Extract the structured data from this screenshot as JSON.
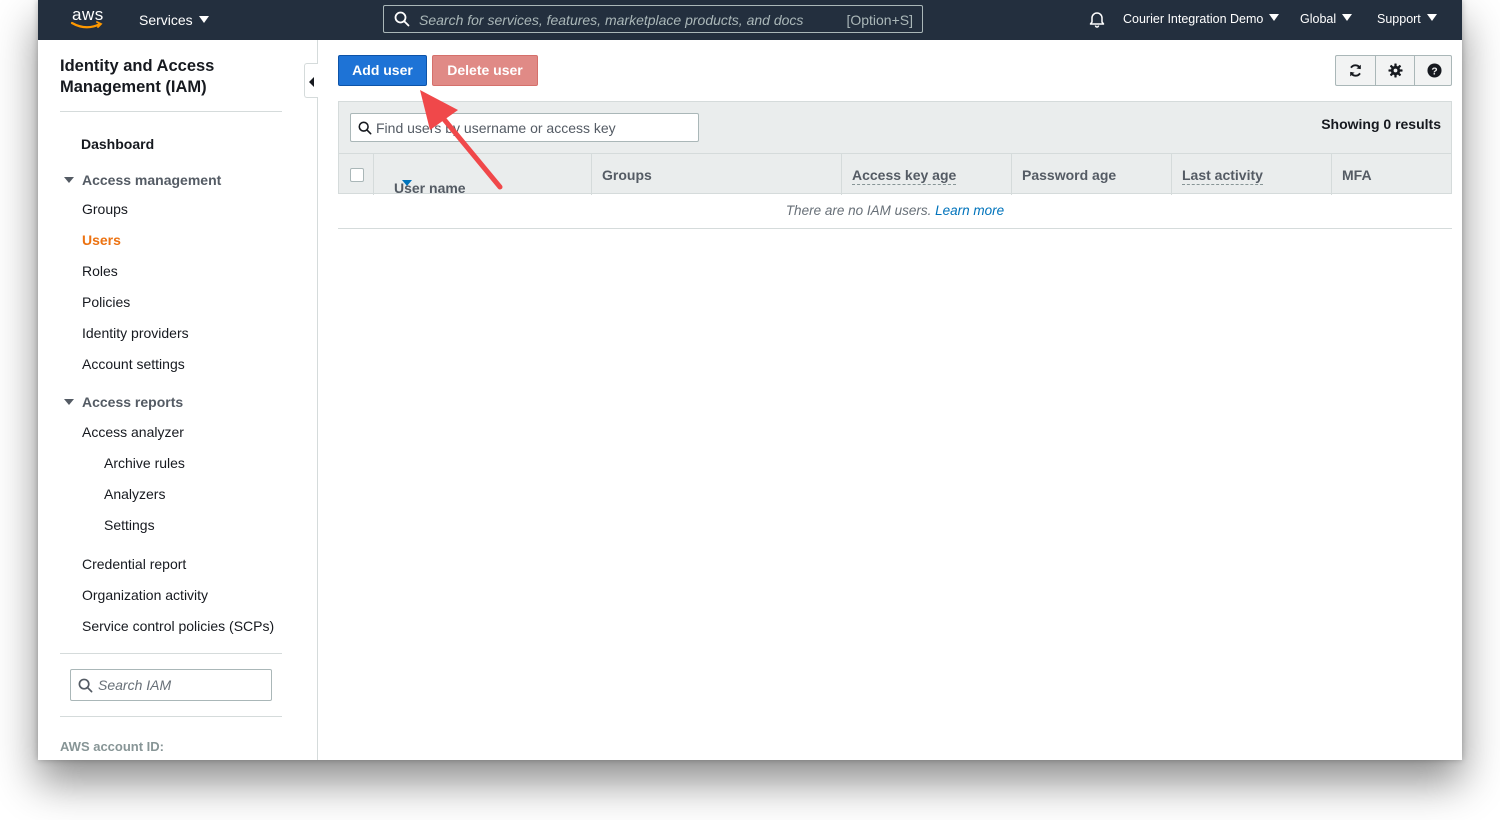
{
  "topnav": {
    "logo_text": "aws",
    "services_label": "Services",
    "search_placeholder": "Search for services, features, marketplace products, and docs",
    "search_shortcut": "[Option+S]",
    "account_label": "Courier Integration Demo",
    "region_label": "Global",
    "support_label": "Support"
  },
  "sidebar": {
    "title": "Identity and Access Management (IAM)",
    "dashboard": "Dashboard",
    "access_management": {
      "heading": "Access management",
      "items": [
        "Groups",
        "Users",
        "Roles",
        "Policies",
        "Identity providers",
        "Account settings"
      ],
      "active": "Users"
    },
    "access_reports": {
      "heading": "Access reports",
      "analyzer": "Access analyzer",
      "sub_items": [
        "Archive rules",
        "Analyzers",
        "Settings"
      ],
      "items": [
        "Credential report",
        "Organization activity",
        "Service control policies (SCPs)"
      ]
    },
    "search_placeholder": "Search IAM",
    "account_id_label": "AWS account ID:"
  },
  "toolbar": {
    "add_user_label": "Add user",
    "delete_user_label": "Delete user"
  },
  "table": {
    "filter_placeholder": "Find users by username or access key",
    "results_text": "Showing 0 results",
    "columns": [
      "User name",
      "Groups",
      "Access key age",
      "Password age",
      "Last activity",
      "MFA"
    ],
    "empty_text": "There are no IAM users.",
    "learn_more_label": "Learn more"
  },
  "colors": {
    "nav_bg": "#232f3e",
    "primary_button": "#1e73d6",
    "delete_button_disabled": "#e08a86",
    "active_nav": "#ec7211",
    "link": "#0073bb",
    "annotation_arrow": "#f0484a"
  }
}
